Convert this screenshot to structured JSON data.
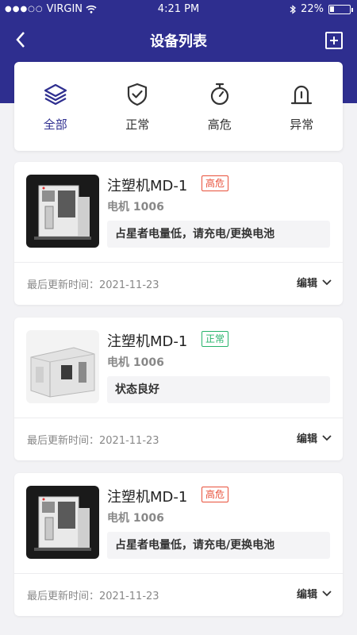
{
  "status_bar": {
    "carrier": "VIRGIN",
    "time": "4:21 PM",
    "battery": "22%"
  },
  "nav": {
    "title": "设备列表",
    "back_icon": "chevron-left-icon",
    "add_icon": "add-square-icon"
  },
  "filters": [
    {
      "label": "全部",
      "icon": "layers-icon",
      "active": true
    },
    {
      "label": "正常",
      "icon": "shield-check-icon",
      "active": false
    },
    {
      "label": "高危",
      "icon": "stopwatch-icon",
      "active": false
    },
    {
      "label": "异常",
      "icon": "warning-light-icon",
      "active": false
    }
  ],
  "devices": [
    {
      "name": "注塑机MD-1",
      "badge": "高危",
      "badge_type": "danger",
      "sub": "电机 1006",
      "message": "占星者电量低，请充电/更换电池",
      "update_label": "最后更新时间：2021-11-23",
      "edit_label": "编辑"
    },
    {
      "name": "注塑机MD-1",
      "badge": "正常",
      "badge_type": "normal",
      "sub": "电机 1006",
      "message": "状态良好",
      "update_label": "最后更新时间：2021-11-23",
      "edit_label": "编辑"
    },
    {
      "name": "注塑机MD-1",
      "badge": "高危",
      "badge_type": "danger",
      "sub": "电机 1006",
      "message": "占星者电量低，请充电/更换电池",
      "update_label": "最后更新时间：2021-11-23",
      "edit_label": "编辑"
    }
  ],
  "colors": {
    "brand": "#2e2e8f",
    "danger": "#e8503a",
    "normal": "#27b36b"
  }
}
